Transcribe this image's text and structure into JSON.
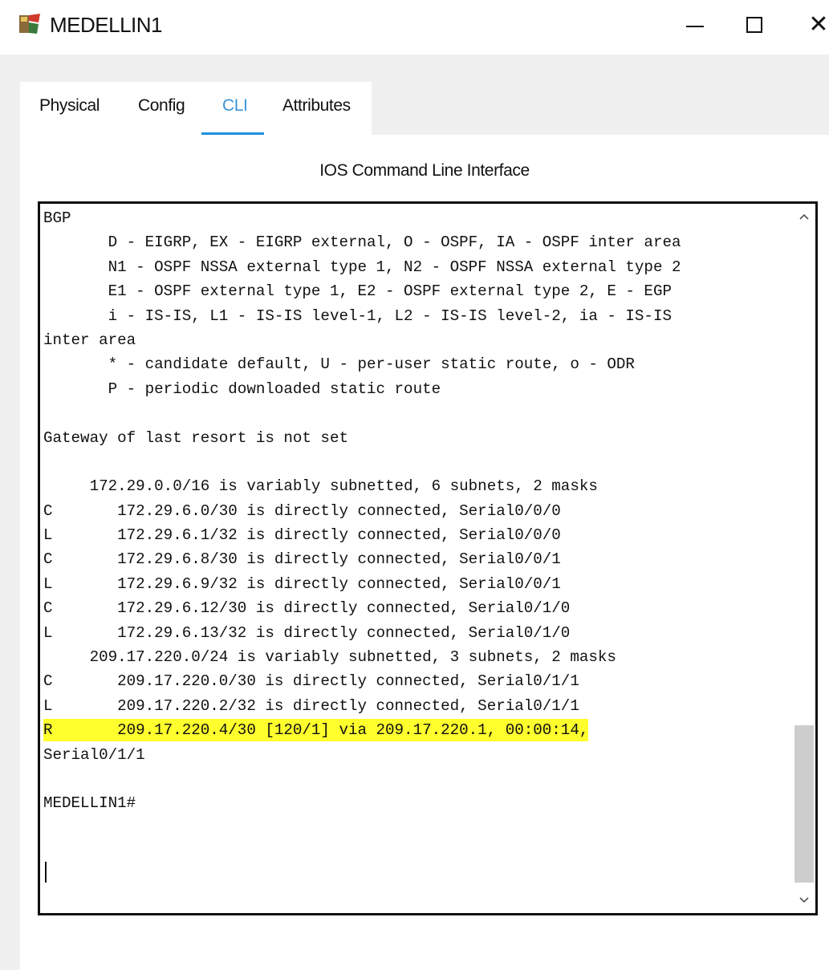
{
  "window": {
    "title": "MEDELLIN1",
    "icon": "router-device-icon"
  },
  "tabs": [
    {
      "label": "Physical",
      "active": false
    },
    {
      "label": "Config",
      "active": false
    },
    {
      "label": "CLI",
      "active": true
    },
    {
      "label": "Attributes",
      "active": false
    }
  ],
  "section_title": "IOS Command Line Interface",
  "cli": {
    "lines": [
      "BGP",
      "       D - EIGRP, EX - EIGRP external, O - OSPF, IA - OSPF inter area",
      "       N1 - OSPF NSSA external type 1, N2 - OSPF NSSA external type 2",
      "       E1 - OSPF external type 1, E2 - OSPF external type 2, E - EGP",
      "       i - IS-IS, L1 - IS-IS level-1, L2 - IS-IS level-2, ia - IS-IS",
      "inter area",
      "       * - candidate default, U - per-user static route, o - ODR",
      "       P - periodic downloaded static route",
      "",
      "Gateway of last resort is not set",
      "",
      "     172.29.0.0/16 is variably subnetted, 6 subnets, 2 masks",
      "C       172.29.6.0/30 is directly connected, Serial0/0/0",
      "L       172.29.6.1/32 is directly connected, Serial0/0/0",
      "C       172.29.6.8/30 is directly connected, Serial0/0/1",
      "L       172.29.6.9/32 is directly connected, Serial0/0/1",
      "C       172.29.6.12/30 is directly connected, Serial0/1/0",
      "L       172.29.6.13/32 is directly connected, Serial0/1/0",
      "     209.17.220.0/24 is variably subnetted, 3 subnets, 2 masks",
      "C       209.17.220.0/30 is directly connected, Serial0/1/1",
      "L       209.17.220.2/32 is directly connected, Serial0/1/1",
      "R       209.17.220.4/30 [120/1] via 209.17.220.1, 00:00:14,",
      "Serial0/1/1",
      "",
      "MEDELLIN1#"
    ],
    "highlighted_line": 21,
    "highlight_color": "#ffff2e"
  },
  "colors": {
    "active_tab_text": "#3a95d8",
    "active_tab_underline": "#1e90e0",
    "panel_background": "#f0f0f0"
  }
}
